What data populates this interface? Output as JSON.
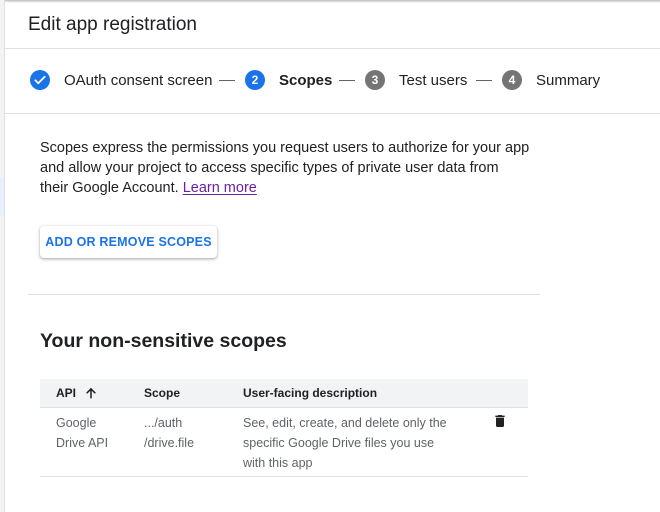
{
  "header": {
    "title": "Edit app registration"
  },
  "stepper": {
    "steps": [
      {
        "number": "",
        "label": "OAuth consent screen",
        "state": "done"
      },
      {
        "number": "2",
        "label": "Scopes",
        "state": "active"
      },
      {
        "number": "3",
        "label": "Test users",
        "state": "todo"
      },
      {
        "number": "4",
        "label": "Summary",
        "state": "todo"
      }
    ]
  },
  "intro": {
    "text": "Scopes express the permissions you request users to authorize for your app and allow your project to access specific types of private user data from their Google Account.",
    "learn_more": "Learn more"
  },
  "add_scopes_button": "ADD OR REMOVE SCOPES",
  "non_sensitive": {
    "title": "Your non-sensitive scopes",
    "columns": {
      "api": "API",
      "scope": "Scope",
      "description": "User-facing description"
    },
    "rows": [
      {
        "api_line1": "Google",
        "api_line2": "Drive API",
        "scope_line1": ".../auth",
        "scope_line2": "/drive.file",
        "desc_line1": "See, edit, create, and delete only the",
        "desc_line2": "specific Google Drive files you use",
        "desc_line3": "with this app"
      }
    ]
  },
  "icons": {
    "checkmark": "check-icon",
    "sort": "arrow-upward-icon",
    "delete": "trash-icon"
  },
  "colors": {
    "accent": "#1a73e8",
    "step_inactive": "#757575",
    "link": "#6b1fa6"
  }
}
